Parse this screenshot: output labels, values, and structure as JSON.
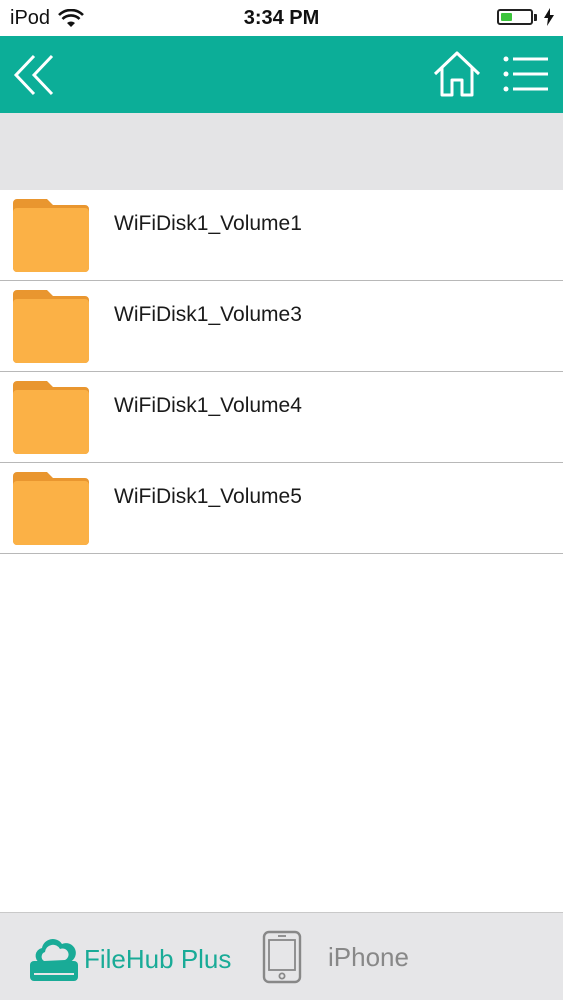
{
  "status_bar": {
    "carrier": "iPod",
    "time": "3:34 PM",
    "battery_percent": 40,
    "icons": [
      "wifi-icon",
      "battery-icon",
      "charging-bolt-icon"
    ]
  },
  "nav_bar": {
    "color": "#0cae98",
    "icons": [
      "double-chevron-left-icon",
      "home-icon",
      "list-menu-icon"
    ]
  },
  "file_list": {
    "items": [
      {
        "label": "WiFiDisk1_Volume1",
        "icon": "folder-icon"
      },
      {
        "label": "WiFiDisk1_Volume3",
        "icon": "folder-icon"
      },
      {
        "label": "WiFiDisk1_Volume4",
        "icon": "folder-icon"
      },
      {
        "label": "WiFiDisk1_Volume5",
        "icon": "folder-icon"
      }
    ]
  },
  "tab_bar": {
    "tabs": [
      {
        "label": "FileHub Plus",
        "icon": "cloud-drive-icon",
        "active": true,
        "color": "#19ab97"
      },
      {
        "label": "iPhone",
        "icon": "phone-icon",
        "active": false,
        "color": "#888888"
      }
    ]
  }
}
